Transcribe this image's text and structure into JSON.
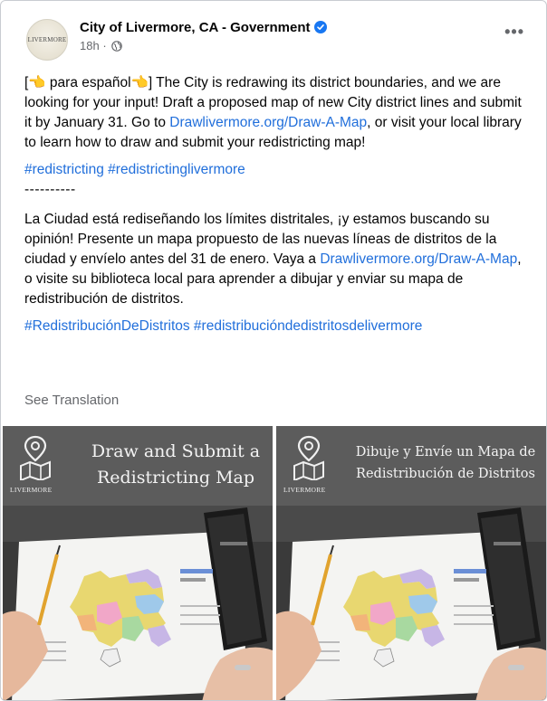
{
  "post": {
    "page_name": "City of Livermore, CA - Government",
    "timestamp": "18h",
    "more_label": "•••",
    "avatar_text": "LIVERMORE",
    "english_text_before_link": "[👈 para español👈] The City is redrawing its district boundaries, and we are looking for your input! Draft a proposed map of new City district lines and submit it by January 31. Go to ",
    "english_link": "Drawlivermore.org/Draw-A-Map",
    "english_text_after_link": ", or visit your local library to learn how to draw and submit your redistricting map!",
    "english_hashtags": "#redistricting #redistrictinglivermore",
    "separator": "----------",
    "spanish_text_before_link": "La Ciudad está rediseñando los límites distritales, ¡y estamos buscando su opinión! Presente un mapa propuesto de las nuevas líneas de distritos de la ciudad y envíelo antes del 31 de enero. Vaya a ",
    "spanish_link": "Drawlivermore.org/Draw-A-Map",
    "spanish_text_after_link": ", o visite su biblioteca local para aprender a dibujar y enviar su mapa de redistribución de distritos.",
    "spanish_hashtags": "#RedistribuciónDeDistritos #redistribucióndedistritosdelivermore",
    "see_translation": "See Translation"
  },
  "images": [
    {
      "title_line1": "Draw and Submit a",
      "title_line2": "Redistricting Map",
      "logo_text": "LIVERMORE"
    },
    {
      "title_line1": "Dibuje y Envíe un Mapa de",
      "title_line2": "Redistribución de Distritos",
      "logo_text": "LIVERMORE"
    }
  ],
  "colors": {
    "link": "#216fdb",
    "verified": "#1877f2",
    "banner": "#5c5c5c",
    "muted": "#65676b"
  }
}
